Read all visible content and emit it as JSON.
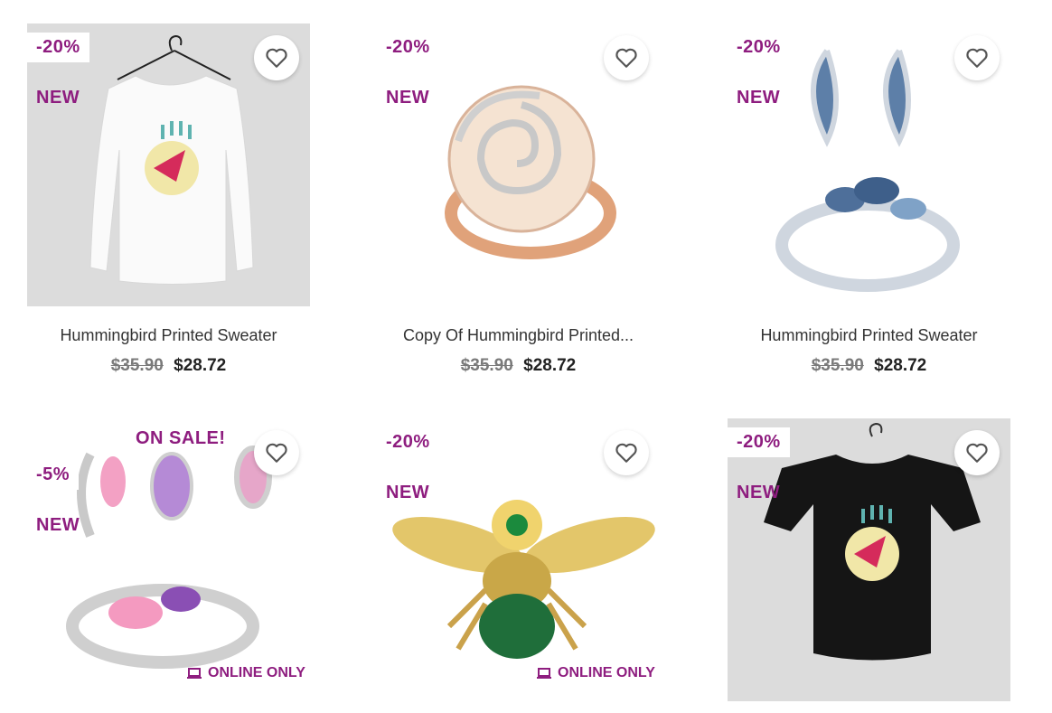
{
  "products": [
    {
      "discount": "-20%",
      "new_label": "NEW",
      "title": "Hummingbird Printed Sweater",
      "old_price": "$35.90",
      "price": "$28.72"
    },
    {
      "discount": "-20%",
      "new_label": "NEW",
      "title": "Copy Of Hummingbird Printed...",
      "old_price": "$35.90",
      "price": "$28.72"
    },
    {
      "discount": "-20%",
      "new_label": "NEW",
      "title": "Hummingbird Printed Sweater",
      "old_price": "$35.90",
      "price": "$28.72"
    },
    {
      "sale_label": "ON SALE!",
      "discount": "-5%",
      "new_label": "NEW",
      "online_label": "ONLINE ONLY"
    },
    {
      "discount": "-20%",
      "new_label": "NEW",
      "online_label": "ONLINE ONLY"
    },
    {
      "discount": "-20%",
      "new_label": "NEW"
    }
  ],
  "colors": {
    "accent": "#8e1d7f",
    "text": "#333333",
    "strike": "#7a7a7a"
  },
  "icons": {
    "wishlist": "heart-outline-icon",
    "online": "laptop-icon"
  }
}
